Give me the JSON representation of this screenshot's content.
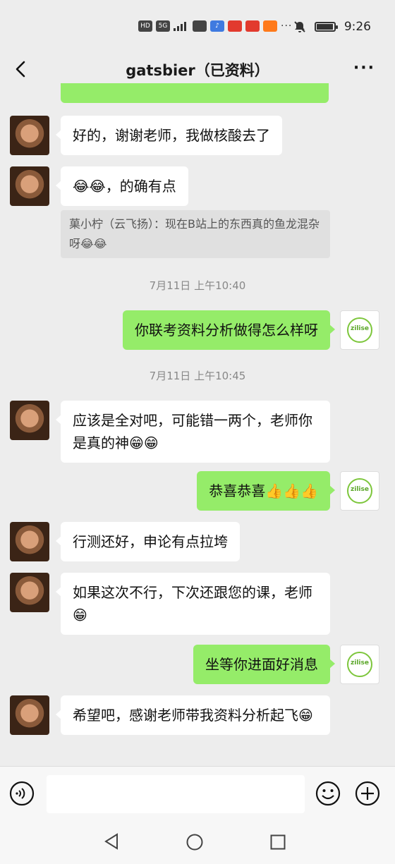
{
  "status_bar": {
    "time": "9:26",
    "chips": [
      "HD",
      "5G",
      "",
      "♪",
      "",
      "",
      ""
    ],
    "more": "···",
    "battery_level": 0.95
  },
  "header": {
    "title": "gatsbier（已资料）",
    "back_icon": "chevron-left-icon",
    "more_icon": "ellipsis-icon",
    "more_label": "···"
  },
  "messages": [
    {
      "side": "left",
      "text": "好的，谢谢老师，我做核酸去了"
    },
    {
      "side": "left",
      "text": "😂😂，的确有点"
    },
    {
      "type": "quote",
      "text": "菓小柠（云飞扬）：现在B站上的东西真的鱼龙混杂呀😂😂"
    },
    {
      "type": "time",
      "text": "7月11日 上午10:40"
    },
    {
      "side": "right",
      "text": "你联考资料分析做得怎么样呀"
    },
    {
      "type": "time",
      "text": "7月11日 上午10:45"
    },
    {
      "side": "left",
      "text": "应该是全对吧，可能错一两个，老师你是真的神😁😁"
    },
    {
      "side": "right",
      "text": "恭喜恭喜👍👍👍"
    },
    {
      "side": "left",
      "text": "行测还好，申论有点拉垮"
    },
    {
      "side": "left",
      "text": "如果这次不行，下次还跟您的课，老师😁"
    },
    {
      "side": "right",
      "text": "坐等你进面好消息"
    },
    {
      "side": "left",
      "text": "希望吧，感谢老师带我资料分析起飞😁"
    }
  ],
  "self_avatar_logo": "zilise",
  "input": {
    "value": "",
    "voice_icon": "voice-icon",
    "emoji_icon": "emoji-icon",
    "plus_icon": "plus-icon"
  },
  "nav": {
    "back_icon": "nav-back-icon",
    "home_icon": "nav-home-icon",
    "recent_icon": "nav-recent-icon"
  },
  "colors": {
    "background": "#ededed",
    "self_bubble": "#95ec69",
    "other_bubble": "#ffffff",
    "quote_bg": "#e0e0e0"
  }
}
